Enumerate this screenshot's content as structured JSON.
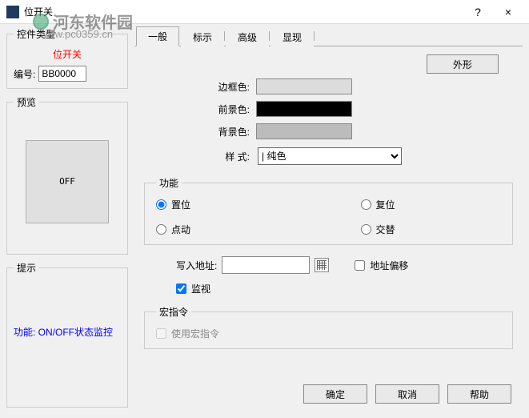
{
  "window": {
    "title": "位开关",
    "help": "?",
    "close": "×"
  },
  "watermark": {
    "name": "河东软件园",
    "url": "www.pc0359.cn"
  },
  "left": {
    "control_type_legend": "控件类型",
    "control_type_value": "位开关",
    "id_label": "编号:",
    "id_value": "BB0000",
    "preview_legend": "预览",
    "preview_text": "OFF",
    "hint_legend": "提示",
    "hint_text": "功能: ON/OFF状态监控"
  },
  "tabs": {
    "general": "一般",
    "mark": "标示",
    "advanced": "高级",
    "display": "显现"
  },
  "right": {
    "shape_btn": "外形",
    "border_color_label": "边框色:",
    "border_color": "#dcdcdc",
    "fg_color_label": "前景色:",
    "fg_color": "#000000",
    "bg_color_label": "背景色:",
    "bg_color": "#bcbcbc",
    "style_label": "样  式:",
    "style_value": "| 纯色",
    "func_legend": "功能",
    "radios": {
      "set": "置位",
      "reset": "复位",
      "jog": "点动",
      "toggle": "交替"
    },
    "addr_label": "写入地址:",
    "addr_offset": "地址偏移",
    "monitor": "监视",
    "macro_legend": "宏指令",
    "use_macro": "使用宏指令"
  },
  "buttons": {
    "ok": "确定",
    "cancel": "取消",
    "help": "帮助"
  }
}
